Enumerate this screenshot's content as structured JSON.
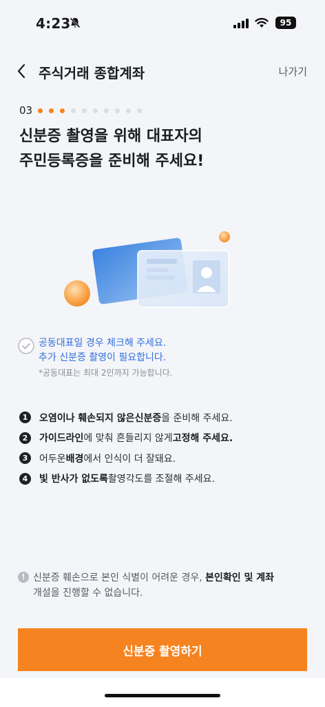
{
  "status_bar": {
    "time": "4:23",
    "battery": "95",
    "icons": [
      "bell-slash-icon",
      "signal-icon",
      "wifi-icon",
      "battery-icon"
    ]
  },
  "nav": {
    "back_icon": "chevron-left-icon",
    "title": "주식거래 종합계좌",
    "exit_label": "나가기"
  },
  "progress": {
    "step_label": "03",
    "total_steps": 10,
    "completed_steps": 3,
    "active_color": "#f5831f",
    "inactive_color": "#dcdde1"
  },
  "headline": {
    "line1": "신분증 촬영을 위해 대표자의",
    "line2": "주민등록증을 준비해 주세요!"
  },
  "illustration": {
    "icon": "id-card-illustration"
  },
  "joint_representative": {
    "checked": false,
    "line1": "공동대표일 경우 체크해 주세요.",
    "line2": "추가 신분증 촬영이 필요합니다.",
    "note": "*공동대표는 최대 2인까지 가능합니다."
  },
  "tips": [
    {
      "num": "1",
      "parts": [
        {
          "t": "오염이나 훼손되지 않은 ",
          "b": true
        },
        {
          "t": "신분증",
          "b": true
        },
        {
          "t": "을 준비해 주세요.",
          "b": false
        }
      ]
    },
    {
      "num": "2",
      "parts": [
        {
          "t": "가이드라인",
          "b": true
        },
        {
          "t": "에 맞춰 흔들리지 않게 ",
          "b": false
        },
        {
          "t": "고정해 주세요.",
          "b": true
        }
      ]
    },
    {
      "num": "3",
      "parts": [
        {
          "t": "어두운 ",
          "b": false
        },
        {
          "t": "배경",
          "b": true
        },
        {
          "t": "에서 인식이 더 잘돼요.",
          "b": false
        }
      ]
    },
    {
      "num": "4",
      "parts": [
        {
          "t": "빛 반사가 없도록",
          "b": true
        },
        {
          "t": " 촬영각도를 조절해 주세요.",
          "b": false
        }
      ]
    }
  ],
  "warning": {
    "icon": "exclamation-circle-icon",
    "line1_a": "신분증 훼손으로 본인 식별이 어려운 경우, ",
    "line1_b": "본인확인 및 계좌",
    "line2": "개설을 진행할 수 없습니다."
  },
  "cta": {
    "label": "신분증 촬영하기",
    "color": "#f5831f"
  }
}
